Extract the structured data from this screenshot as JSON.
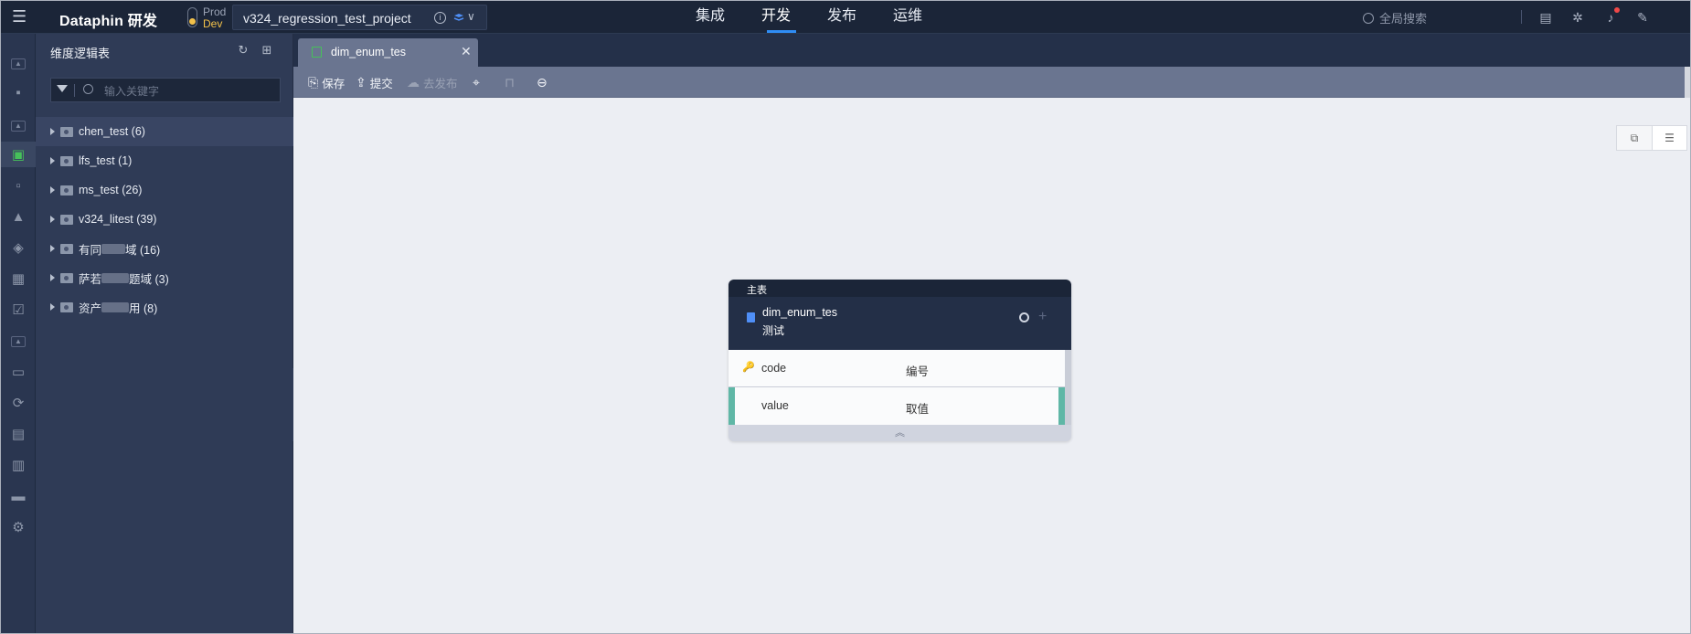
{
  "app": {
    "logo": "Dataphin 研发"
  },
  "env": {
    "prod": "Prod",
    "dev": "Dev"
  },
  "project": {
    "name": "v324_regression_test_project"
  },
  "nav": [
    {
      "label": "集成",
      "active": false
    },
    {
      "label": "开发",
      "active": true
    },
    {
      "label": "发布",
      "active": false
    },
    {
      "label": "运维",
      "active": false
    }
  ],
  "global_search": {
    "placeholder": "全局搜索"
  },
  "panel": {
    "title": "维度逻辑表",
    "search_placeholder": "输入关键字",
    "tree": [
      {
        "label": "chen_test (6)"
      },
      {
        "label": "lfs_test (1)"
      },
      {
        "label": "ms_test (26)"
      },
      {
        "label": "v324_litest (39)"
      },
      {
        "prefix": "有同",
        "suffix": "域 (16)"
      },
      {
        "prefix": "萨若",
        "suffix": "题域 (3)"
      },
      {
        "prefix": "资产",
        "suffix": "用 (8)"
      }
    ]
  },
  "tab": {
    "label": "dim_enum_tes"
  },
  "toolbar": {
    "save": "保存",
    "submit": "提交",
    "publish": "去发布"
  },
  "card": {
    "tag": "主表",
    "name": "dim_enum_tes",
    "subtitle": "测试",
    "fields": [
      {
        "name": "code",
        "desc": "编号",
        "key": true
      },
      {
        "name": "value",
        "desc": "取值",
        "key": false
      }
    ]
  },
  "colors": {
    "accent": "#2f8df5",
    "active_green": "#46c15a",
    "dev_yellow": "#f2c14a"
  }
}
